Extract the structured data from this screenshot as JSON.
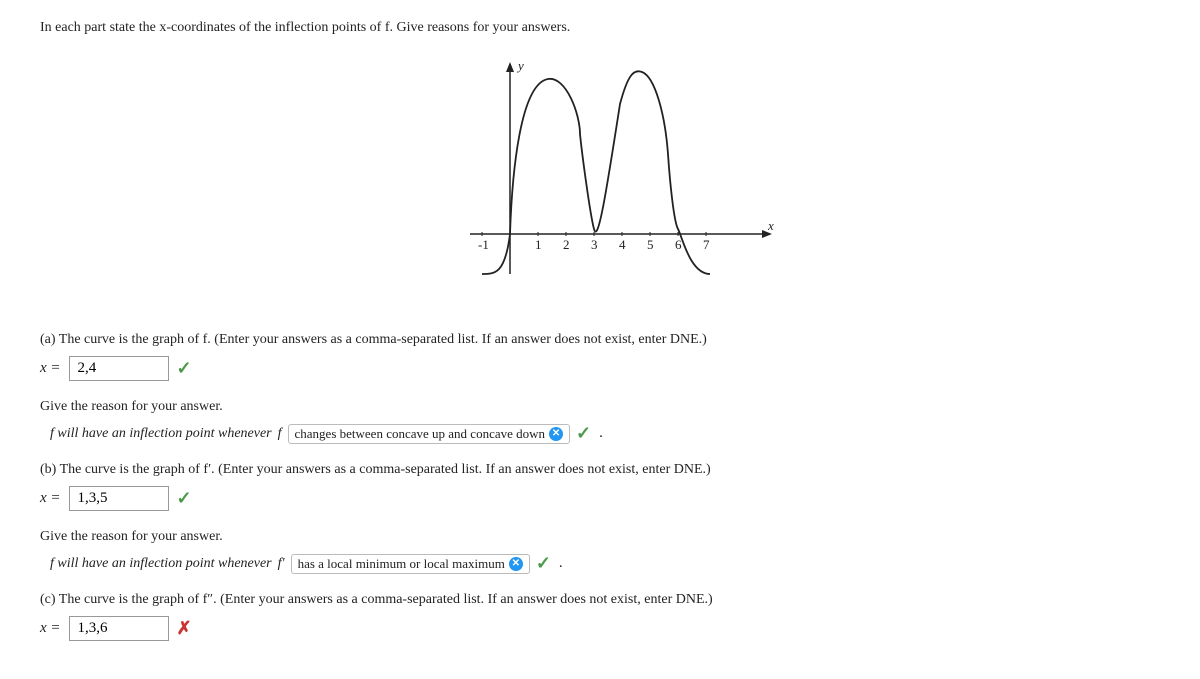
{
  "header": {
    "text": "In each part state the x-coordinates of the inflection points of f. Give reasons for your answers."
  },
  "part_a": {
    "label": "(a) The curve is the graph of f. (Enter your answers as a comma-separated list. If an answer does not exist, enter DNE.)",
    "x_label": "x =",
    "answer": "2,4",
    "reason_prefix": "f will have an inflection point whenever",
    "f_label": "f",
    "dropdown_text": "changes between concave up and concave down",
    "status": "correct"
  },
  "reason_a": {
    "label": "Give the reason for your answer."
  },
  "part_b": {
    "label": "(b) The curve is the graph of f′. (Enter your answers as a comma-separated list. If an answer does not exist, enter DNE.)",
    "x_label": "x =",
    "answer": "1,3,5",
    "reason_prefix": "f will have an inflection point whenever",
    "f_label": "f′",
    "dropdown_text": "has a local minimum or local maximum",
    "status": "correct"
  },
  "reason_b": {
    "label": "Give the reason for your answer."
  },
  "part_c": {
    "label": "(c) The curve is the graph of f″. (Enter your answers as a comma-separated list. If an answer does not exist, enter DNE.)",
    "x_label": "x =",
    "answer": "1,3,6",
    "status": "incorrect"
  },
  "graph": {
    "x_label": "x",
    "y_label": "y",
    "x_ticks": [
      "-1",
      "1",
      "2",
      "3",
      "4",
      "5",
      "6",
      "7"
    ]
  }
}
